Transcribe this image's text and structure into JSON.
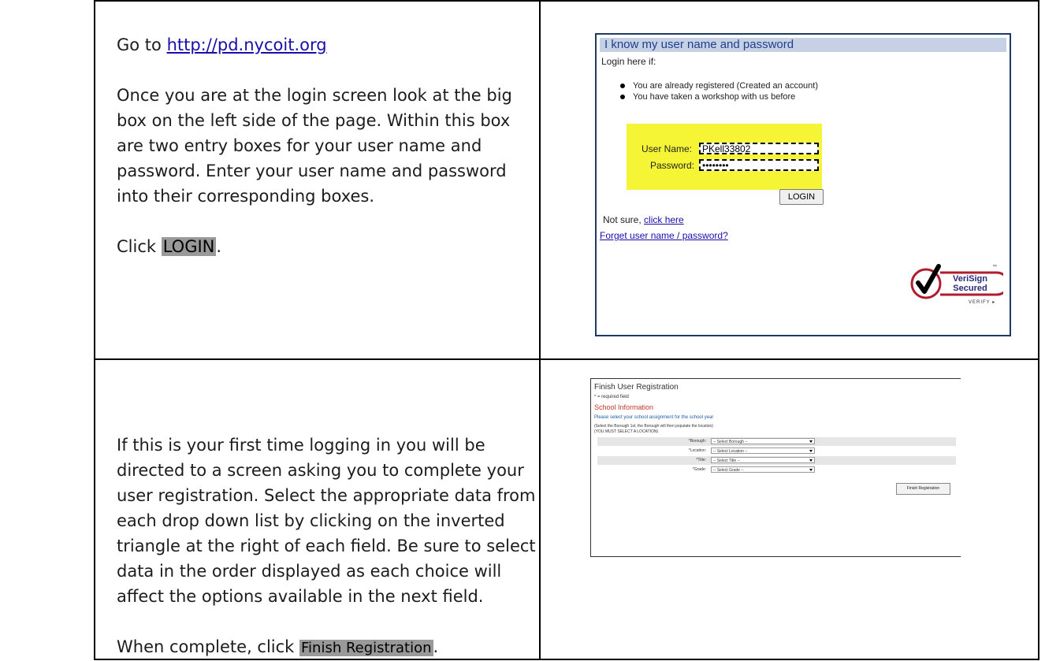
{
  "row1": {
    "goto_prefix": "Go to ",
    "url_text": "http://pd.nycoit.org",
    "instructions": "Once you are at the login screen look at the big box on the left side of the page. Within this box are two entry boxes for your user name and password. Enter your user name and password into their corresponding boxes.",
    "click_prefix": "Click ",
    "click_button": "LOGIN",
    "click_suffix": "."
  },
  "login_screen": {
    "header": "I know my user name and password",
    "login_here": "Login here if:",
    "bullets": [
      "You are already registered (Created an account)",
      "You have taken a workshop with us before"
    ],
    "username_label": "User Name:",
    "username_value": "PKell33802",
    "password_label": "Password:",
    "password_value": "••••••••",
    "login_button": "LOGIN",
    "not_sure": "Not sure, ",
    "click_here": "click here",
    "forget": "Forget user name / password?",
    "verisign_line1": "VeriSign",
    "verisign_line2": "Secured",
    "verisign_tm": "™",
    "verify": "VERIFY ▸"
  },
  "row2": {
    "instructions": "If this is your first time logging in you will be directed to a screen asking you to complete your user registration. Select the appropriate data from each drop down list by clicking on the inverted triangle at the right of each field. Be sure to select data in the order displayed as each choice will affect the options available in the next field.",
    "complete_prefix": "When complete, click ",
    "complete_button": "Finish Registration",
    "complete_suffix": "."
  },
  "registration_screen": {
    "title": "Finish User Registration",
    "required_note": "* = required field",
    "section": "School Information",
    "please": "Please select your school assignment for the school year",
    "select_note": "(Select the Borough 1st, the Borough will then populate the location)",
    "must_select": "(YOU MUST SELECT A LOCATION)",
    "fields": [
      {
        "label": "*Borough:",
        "placeholder": "-- Select Borough --"
      },
      {
        "label": "*Location:",
        "placeholder": "-- Select Location --"
      },
      {
        "label": "*Title:",
        "placeholder": "-- Select Title --"
      },
      {
        "label": "*Grade:",
        "placeholder": "-- Select Grade --"
      }
    ],
    "finish_button": "Finish Registration"
  }
}
